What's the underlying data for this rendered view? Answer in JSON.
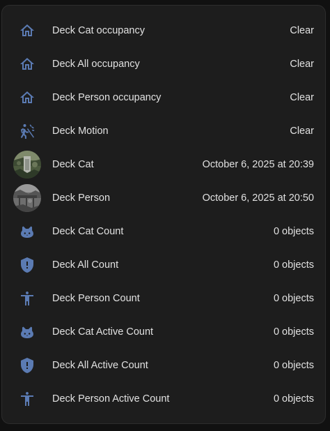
{
  "colors": {
    "background": "#111111",
    "card": "#1d1d1d",
    "icon": "#5b7bb3",
    "text": "#e1e1e1"
  },
  "entities": [
    {
      "name": "Deck Cat occupancy",
      "state": "Clear",
      "icon": "home-outline-icon"
    },
    {
      "name": "Deck All occupancy",
      "state": "Clear",
      "icon": "home-outline-icon"
    },
    {
      "name": "Deck Person occupancy",
      "state": "Clear",
      "icon": "home-outline-icon"
    },
    {
      "name": "Deck Motion",
      "state": "Clear",
      "icon": "walk-motion-icon"
    },
    {
      "name": "Deck Cat",
      "state": "October 6, 2025 at 20:39",
      "icon": "camera-snapshot-avatar"
    },
    {
      "name": "Deck Person",
      "state": "October 6, 2025 at 20:50",
      "icon": "camera-snapshot-avatar"
    },
    {
      "name": "Deck Cat Count",
      "state": "0 objects",
      "icon": "cat-icon"
    },
    {
      "name": "Deck All Count",
      "state": "0 objects",
      "icon": "shield-alert-icon"
    },
    {
      "name": "Deck Person Count",
      "state": "0 objects",
      "icon": "human-icon"
    },
    {
      "name": "Deck Cat Active Count",
      "state": "0 objects",
      "icon": "cat-icon"
    },
    {
      "name": "Deck All Active Count",
      "state": "0 objects",
      "icon": "shield-alert-icon"
    },
    {
      "name": "Deck Person Active Count",
      "state": "0 objects",
      "icon": "human-icon"
    }
  ]
}
